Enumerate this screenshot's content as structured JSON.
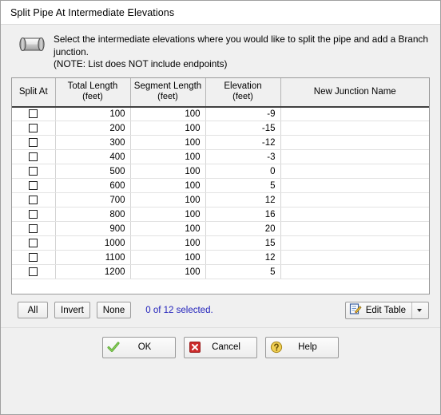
{
  "window": {
    "title": "Split Pipe At Intermediate Elevations"
  },
  "instruction": {
    "icon": "pipe-icon",
    "line1": "Select the intermediate elevations where you would like to split the pipe and add a Branch",
    "line2": "junction.",
    "line3": "(NOTE: List does NOT include endpoints)"
  },
  "table": {
    "columns": [
      {
        "title": "Split At",
        "unit": ""
      },
      {
        "title": "Total Length",
        "unit": "(feet)"
      },
      {
        "title": "Segment Length",
        "unit": "(feet)"
      },
      {
        "title": "Elevation",
        "unit": "(feet)"
      },
      {
        "title": "New Junction Name",
        "unit": ""
      }
    ],
    "rows": [
      {
        "checked": false,
        "total_length": "100",
        "segment_length": "100",
        "elevation": "-9",
        "junction_name": ""
      },
      {
        "checked": false,
        "total_length": "200",
        "segment_length": "100",
        "elevation": "-15",
        "junction_name": ""
      },
      {
        "checked": false,
        "total_length": "300",
        "segment_length": "100",
        "elevation": "-12",
        "junction_name": ""
      },
      {
        "checked": false,
        "total_length": "400",
        "segment_length": "100",
        "elevation": "-3",
        "junction_name": ""
      },
      {
        "checked": false,
        "total_length": "500",
        "segment_length": "100",
        "elevation": "0",
        "junction_name": ""
      },
      {
        "checked": false,
        "total_length": "600",
        "segment_length": "100",
        "elevation": "5",
        "junction_name": ""
      },
      {
        "checked": false,
        "total_length": "700",
        "segment_length": "100",
        "elevation": "12",
        "junction_name": ""
      },
      {
        "checked": false,
        "total_length": "800",
        "segment_length": "100",
        "elevation": "16",
        "junction_name": ""
      },
      {
        "checked": false,
        "total_length": "900",
        "segment_length": "100",
        "elevation": "20",
        "junction_name": ""
      },
      {
        "checked": false,
        "total_length": "1000",
        "segment_length": "100",
        "elevation": "15",
        "junction_name": ""
      },
      {
        "checked": false,
        "total_length": "1100",
        "segment_length": "100",
        "elevation": "12",
        "junction_name": ""
      },
      {
        "checked": false,
        "total_length": "1200",
        "segment_length": "100",
        "elevation": "5",
        "junction_name": ""
      }
    ],
    "focused_cell": {
      "row": 0,
      "column": "total_length"
    }
  },
  "selection_bar": {
    "all_label": "All",
    "invert_label": "Invert",
    "none_label": "None",
    "status": "0 of 12 selected.",
    "status_color": "#2222bb",
    "edit_table_label": "Edit Table",
    "edit_table_icon": "pencil-notepad-icon",
    "dropdown_icon": "chevron-down-icon"
  },
  "footer": {
    "ok_label": "OK",
    "ok_icon": "green-check-icon",
    "cancel_label": "Cancel",
    "cancel_icon": "red-x-icon",
    "help_label": "Help",
    "help_icon": "yellow-question-icon"
  },
  "colors": {
    "selection_blue": "#9db8d2",
    "filler_gray": "#a8a8a8",
    "dialog_bg": "#f0f0f0"
  }
}
